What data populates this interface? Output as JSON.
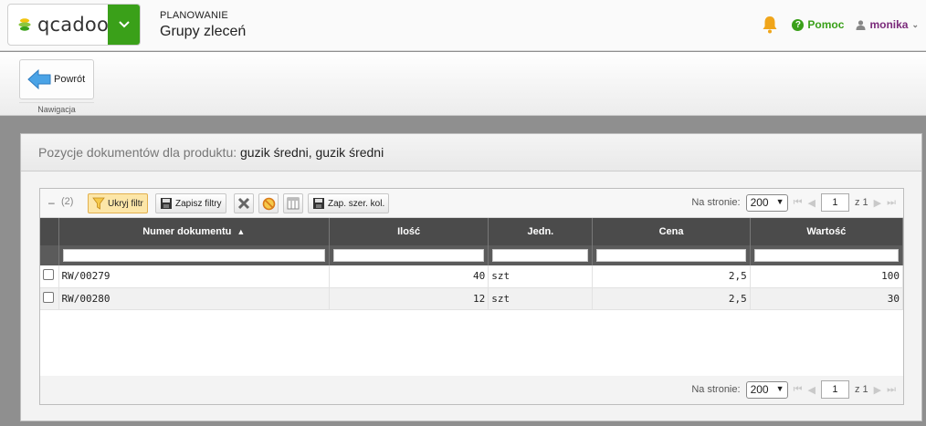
{
  "header": {
    "logo_text": "qcadoo",
    "category": "PLANOWANIE",
    "title": "Grupy zleceń",
    "help_label": "Pomoc",
    "user_name": "monika",
    "accent": "#3aa019",
    "user_color": "#7b2b7b"
  },
  "ribbon": {
    "back_label": "Powrót",
    "group_label": "Nawigacja"
  },
  "panel": {
    "label": "Pozycje dokumentów dla produktu:",
    "value": "guzik średni, guzik średni"
  },
  "grid": {
    "collapse_symbol": "–",
    "count": "(2)",
    "toolbar": {
      "hide_filter": "Ukryj filtr",
      "save_filters": "Zapisz filtry",
      "save_col_widths": "Zap. szer. kol."
    },
    "pager": {
      "per_page_label": "Na stronie:",
      "per_page_value": "200",
      "page": "1",
      "of_label": "z 1"
    },
    "columns": [
      "Numer dokumentu",
      "Ilość",
      "Jedn.",
      "Cena",
      "Wartość"
    ],
    "rows": [
      {
        "number": "RW/00279",
        "qty": "40",
        "unit": "szt",
        "price": "2,5",
        "value": "100"
      },
      {
        "number": "RW/00280",
        "qty": "12",
        "unit": "szt",
        "price": "2,5",
        "value": "30"
      }
    ]
  }
}
